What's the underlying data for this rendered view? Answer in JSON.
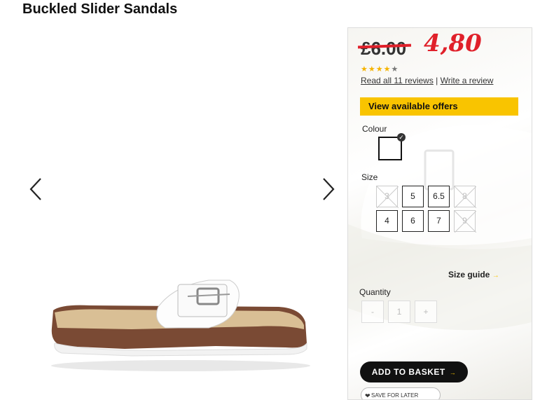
{
  "product": {
    "title": "Buckled Slider Sandals"
  },
  "price": {
    "old": "£6.00",
    "new": "4,80"
  },
  "rating": {
    "stars_filled": 4,
    "stars_total": 5,
    "reviews_link": "Read all 11 reviews",
    "separator": "|",
    "write_review_link": "Write a review"
  },
  "offers_button": "View available offers",
  "colour": {
    "label": "Colour",
    "selected": "white"
  },
  "size": {
    "label": "Size",
    "options": [
      {
        "label": "3",
        "available": false
      },
      {
        "label": "5",
        "available": true
      },
      {
        "label": "6.5",
        "available": true
      },
      {
        "label": "8",
        "available": false
      },
      {
        "label": "4",
        "available": true
      },
      {
        "label": "6",
        "available": true
      },
      {
        "label": "7",
        "available": true
      },
      {
        "label": "9",
        "available": false
      }
    ],
    "guide": "Size guide"
  },
  "quantity": {
    "label": "Quantity",
    "minus": "-",
    "value": "1",
    "plus": "+"
  },
  "basket_button": "ADD TO BASKET",
  "save_button": "SAVE FOR LATER",
  "colors": {
    "accent_yellow": "#f9c400",
    "price_red": "#e0202a",
    "button_black": "#111111"
  }
}
